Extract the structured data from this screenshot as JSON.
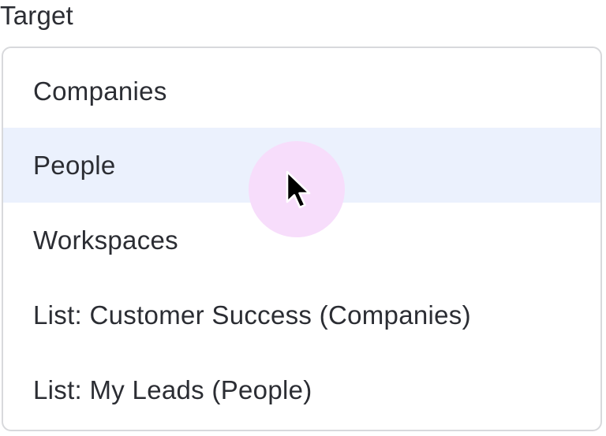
{
  "field": {
    "label": "Target"
  },
  "dropdown": {
    "options": [
      {
        "label": "Companies"
      },
      {
        "label": "People"
      },
      {
        "label": "Workspaces"
      },
      {
        "label": "List: Customer Success (Companies)"
      },
      {
        "label": "List: My Leads (People)"
      }
    ],
    "hovered_option": "People"
  },
  "colors": {
    "hover_background": "#ebf1fd",
    "cursor_halo": "#f7ddfb",
    "text": "#2b2d33",
    "border": "#d8d9dc"
  },
  "cursor": {
    "icon": "mouse-pointer-icon"
  }
}
